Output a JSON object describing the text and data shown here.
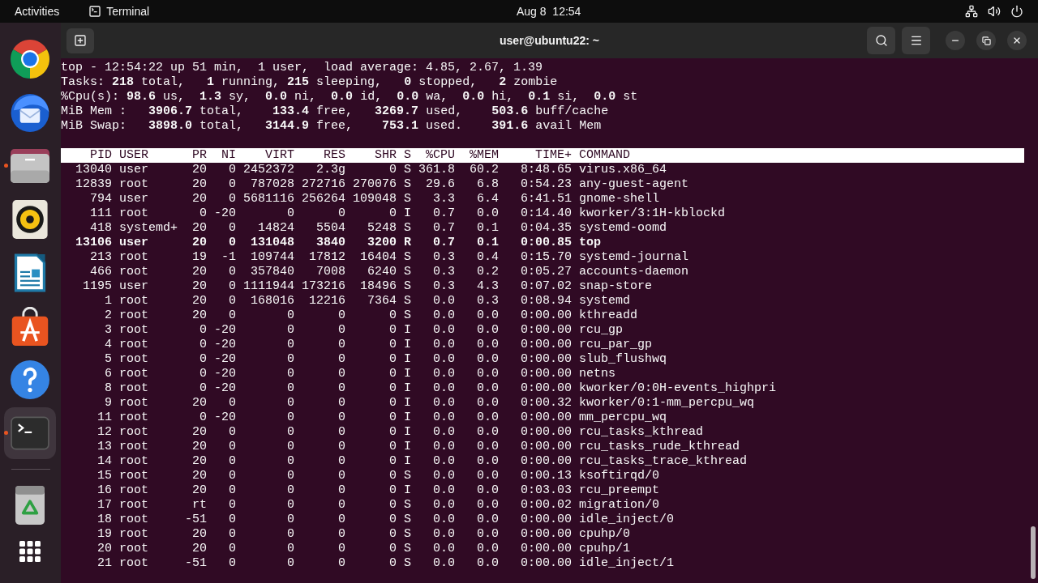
{
  "top_bar": {
    "activities": "Activities",
    "app_menu": "Terminal",
    "clock": "Aug 8  12:54"
  },
  "dock": {
    "items": [
      {
        "kind": "browser",
        "running": false,
        "selected": false
      },
      {
        "kind": "mail",
        "running": false,
        "selected": false
      },
      {
        "kind": "files",
        "running": true,
        "selected": false
      },
      {
        "kind": "music",
        "running": false,
        "selected": false
      },
      {
        "kind": "writer",
        "running": false,
        "selected": false
      },
      {
        "kind": "store",
        "running": false,
        "selected": false
      },
      {
        "kind": "help",
        "running": false,
        "selected": false
      },
      {
        "kind": "terminal",
        "running": true,
        "selected": true
      }
    ],
    "extras": [
      {
        "kind": "trash"
      },
      {
        "kind": "app-grid"
      }
    ]
  },
  "window": {
    "title": "user@ubuntu22: ~"
  },
  "terminal": {
    "summary": [
      "top - 12:54:22 up 51 min,  1 user,  load average: 4.85, 2.67, 1.39",
      "Tasks: **218** total,   **1** running, **215** sleeping,   **0** stopped,   **2** zombie",
      "%Cpu(s): **98.6** us,  **1.3** sy,  **0.0** ni,  **0.0** id,  **0.0** wa,  **0.0** hi,  **0.1** si,  **0.0** st",
      "MiB Mem :   **3906.7** total,    **133.4** free,   **3269.7** used,    **503.6** buff/cache",
      "MiB Swap:   **3898.0** total,   **3144.9** free,    **753.1** used.    **391.6** avail Mem"
    ],
    "table": {
      "columns": [
        "PID",
        "USER",
        "PR",
        "NI",
        "VIRT",
        "RES",
        "SHR",
        "S",
        "%CPU",
        "%MEM",
        "TIME+",
        "COMMAND"
      ],
      "rows": [
        {
          "cells": [
            "13040",
            "user",
            "20",
            "0",
            "2452372",
            "2.3g",
            "0",
            "S",
            "361.8",
            "60.2",
            "8:48.65",
            "virus.x86_64"
          ],
          "bold": false
        },
        {
          "cells": [
            "12839",
            "root",
            "20",
            "0",
            "787028",
            "272716",
            "270076",
            "S",
            "29.6",
            "6.8",
            "0:54.23",
            "any-guest-agent"
          ],
          "bold": false
        },
        {
          "cells": [
            "794",
            "user",
            "20",
            "0",
            "5681116",
            "256264",
            "109048",
            "S",
            "3.3",
            "6.4",
            "6:41.51",
            "gnome-shell"
          ],
          "bold": false
        },
        {
          "cells": [
            "111",
            "root",
            "0",
            "-20",
            "0",
            "0",
            "0",
            "I",
            "0.7",
            "0.0",
            "0:14.40",
            "kworker/3:1H-kblockd"
          ],
          "bold": false
        },
        {
          "cells": [
            "418",
            "systemd+",
            "20",
            "0",
            "14824",
            "5504",
            "5248",
            "S",
            "0.7",
            "0.1",
            "0:04.35",
            "systemd-oomd"
          ],
          "bold": false
        },
        {
          "cells": [
            "13106",
            "user",
            "20",
            "0",
            "131048",
            "3840",
            "3200",
            "R",
            "0.7",
            "0.1",
            "0:00.85",
            "top"
          ],
          "bold": true
        },
        {
          "cells": [
            "213",
            "root",
            "19",
            "-1",
            "109744",
            "17812",
            "16404",
            "S",
            "0.3",
            "0.4",
            "0:15.70",
            "systemd-journal"
          ],
          "bold": false
        },
        {
          "cells": [
            "466",
            "root",
            "20",
            "0",
            "357840",
            "7008",
            "6240",
            "S",
            "0.3",
            "0.2",
            "0:05.27",
            "accounts-daemon"
          ],
          "bold": false
        },
        {
          "cells": [
            "1195",
            "user",
            "20",
            "0",
            "1111944",
            "173216",
            "18496",
            "S",
            "0.3",
            "4.3",
            "0:07.02",
            "snap-store"
          ],
          "bold": false
        },
        {
          "cells": [
            "1",
            "root",
            "20",
            "0",
            "168016",
            "12216",
            "7364",
            "S",
            "0.0",
            "0.3",
            "0:08.94",
            "systemd"
          ],
          "bold": false
        },
        {
          "cells": [
            "2",
            "root",
            "20",
            "0",
            "0",
            "0",
            "0",
            "S",
            "0.0",
            "0.0",
            "0:00.00",
            "kthreadd"
          ],
          "bold": false
        },
        {
          "cells": [
            "3",
            "root",
            "0",
            "-20",
            "0",
            "0",
            "0",
            "I",
            "0.0",
            "0.0",
            "0:00.00",
            "rcu_gp"
          ],
          "bold": false
        },
        {
          "cells": [
            "4",
            "root",
            "0",
            "-20",
            "0",
            "0",
            "0",
            "I",
            "0.0",
            "0.0",
            "0:00.00",
            "rcu_par_gp"
          ],
          "bold": false
        },
        {
          "cells": [
            "5",
            "root",
            "0",
            "-20",
            "0",
            "0",
            "0",
            "I",
            "0.0",
            "0.0",
            "0:00.00",
            "slub_flushwq"
          ],
          "bold": false
        },
        {
          "cells": [
            "6",
            "root",
            "0",
            "-20",
            "0",
            "0",
            "0",
            "I",
            "0.0",
            "0.0",
            "0:00.00",
            "netns"
          ],
          "bold": false
        },
        {
          "cells": [
            "8",
            "root",
            "0",
            "-20",
            "0",
            "0",
            "0",
            "I",
            "0.0",
            "0.0",
            "0:00.00",
            "kworker/0:0H-events_highpri"
          ],
          "bold": false
        },
        {
          "cells": [
            "9",
            "root",
            "20",
            "0",
            "0",
            "0",
            "0",
            "I",
            "0.0",
            "0.0",
            "0:00.32",
            "kworker/0:1-mm_percpu_wq"
          ],
          "bold": false
        },
        {
          "cells": [
            "11",
            "root",
            "0",
            "-20",
            "0",
            "0",
            "0",
            "I",
            "0.0",
            "0.0",
            "0:00.00",
            "mm_percpu_wq"
          ],
          "bold": false
        },
        {
          "cells": [
            "12",
            "root",
            "20",
            "0",
            "0",
            "0",
            "0",
            "I",
            "0.0",
            "0.0",
            "0:00.00",
            "rcu_tasks_kthread"
          ],
          "bold": false
        },
        {
          "cells": [
            "13",
            "root",
            "20",
            "0",
            "0",
            "0",
            "0",
            "I",
            "0.0",
            "0.0",
            "0:00.00",
            "rcu_tasks_rude_kthread"
          ],
          "bold": false
        },
        {
          "cells": [
            "14",
            "root",
            "20",
            "0",
            "0",
            "0",
            "0",
            "I",
            "0.0",
            "0.0",
            "0:00.00",
            "rcu_tasks_trace_kthread"
          ],
          "bold": false
        },
        {
          "cells": [
            "15",
            "root",
            "20",
            "0",
            "0",
            "0",
            "0",
            "S",
            "0.0",
            "0.0",
            "0:00.13",
            "ksoftirqd/0"
          ],
          "bold": false
        },
        {
          "cells": [
            "16",
            "root",
            "20",
            "0",
            "0",
            "0",
            "0",
            "I",
            "0.0",
            "0.0",
            "0:03.03",
            "rcu_preempt"
          ],
          "bold": false
        },
        {
          "cells": [
            "17",
            "root",
            "rt",
            "0",
            "0",
            "0",
            "0",
            "S",
            "0.0",
            "0.0",
            "0:00.02",
            "migration/0"
          ],
          "bold": false
        },
        {
          "cells": [
            "18",
            "root",
            "-51",
            "0",
            "0",
            "0",
            "0",
            "S",
            "0.0",
            "0.0",
            "0:00.00",
            "idle_inject/0"
          ],
          "bold": false
        },
        {
          "cells": [
            "19",
            "root",
            "20",
            "0",
            "0",
            "0",
            "0",
            "S",
            "0.0",
            "0.0",
            "0:00.00",
            "cpuhp/0"
          ],
          "bold": false
        },
        {
          "cells": [
            "20",
            "root",
            "20",
            "0",
            "0",
            "0",
            "0",
            "S",
            "0.0",
            "0.0",
            "0:00.00",
            "cpuhp/1"
          ],
          "bold": false
        },
        {
          "cells": [
            "21",
            "root",
            "-51",
            "0",
            "0",
            "0",
            "0",
            "S",
            "0.0",
            "0.0",
            "0:00.00",
            "idle_inject/1"
          ],
          "bold": false
        }
      ]
    }
  }
}
